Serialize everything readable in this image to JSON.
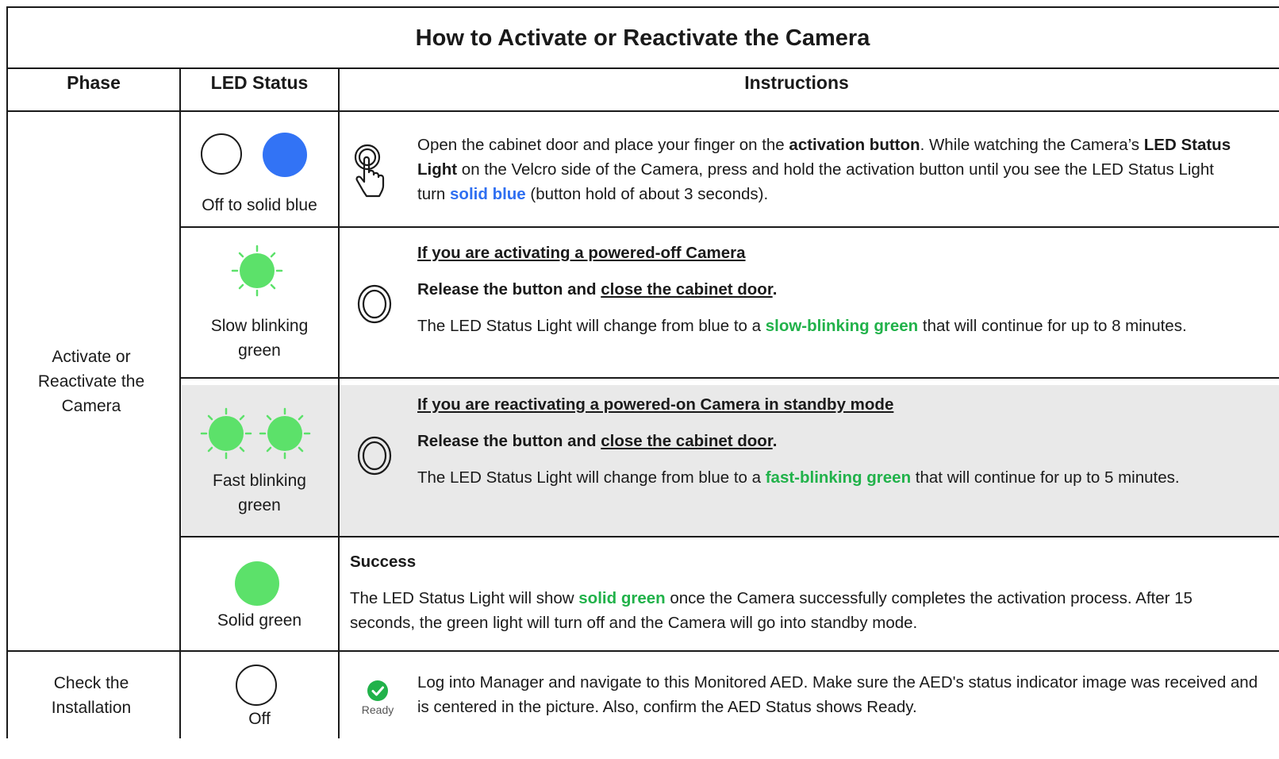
{
  "title": "How to Activate or Reactivate the Camera",
  "headers": {
    "phase": "Phase",
    "led": "LED Status",
    "instructions": "Instructions"
  },
  "colors": {
    "blue": "#2f6ff1",
    "green": "#21b24a",
    "led_green": "#5ce16a",
    "led_blue": "#3273f5",
    "shade": "#e9e9e9"
  },
  "phases": {
    "activate": "Activate or Reactivate the Camera",
    "check": "Check the Installation"
  },
  "rows": {
    "r1": {
      "led_label": "Off to solid blue",
      "icon": "finger-press-icon",
      "t1": "Open the cabinet door and place your finger on the ",
      "t1b": "activation button",
      "t2": ". While watching the Camera’s ",
      "t2b": "LED Status Light",
      "t3": " on the Velcro side of the Camera, press and hold the activation button until you see the LED Status Light turn ",
      "t3c": "solid blue",
      "t4": " (button hold of about 3 seconds)."
    },
    "r2": {
      "led_label": "Slow blinking green",
      "icon": "release-button-icon",
      "heading": "If you are activating a powered-off Camera",
      "release": "Release the button and ",
      "release_u": "close the cabinet door",
      "release_end": ".",
      "t1": "The LED Status Light will change from blue to a ",
      "t1c": "slow-blinking green",
      "t2": " that will continue for up to 8 minutes."
    },
    "r3": {
      "led_label": "Fast blinking green",
      "icon": "release-button-icon",
      "heading": "If you are reactivating a powered-on Camera in standby mode",
      "release": "Release the button and ",
      "release_u": "close the cabinet door",
      "release_end": ".",
      "t1": "The LED Status Light will change from blue to a ",
      "t1c": "fast-blinking green",
      "t2": " that will continue for up to 5 minutes."
    },
    "r4": {
      "led_label": "Solid green",
      "heading": "Success",
      "t1": "The LED Status Light will show ",
      "t1c": "solid green",
      "t2": " once the Camera successfully completes the activation process. After 15 seconds, the green light will turn off and the Camera will go into standby mode."
    },
    "r5": {
      "led_label": "Off",
      "icon": "ready-check-icon",
      "ready_label": "Ready",
      "text": "Log into Manager and navigate to this Monitored AED. Make sure the AED's status indicator image was received and is centered in the picture. Also, confirm the AED Status shows Ready."
    }
  }
}
